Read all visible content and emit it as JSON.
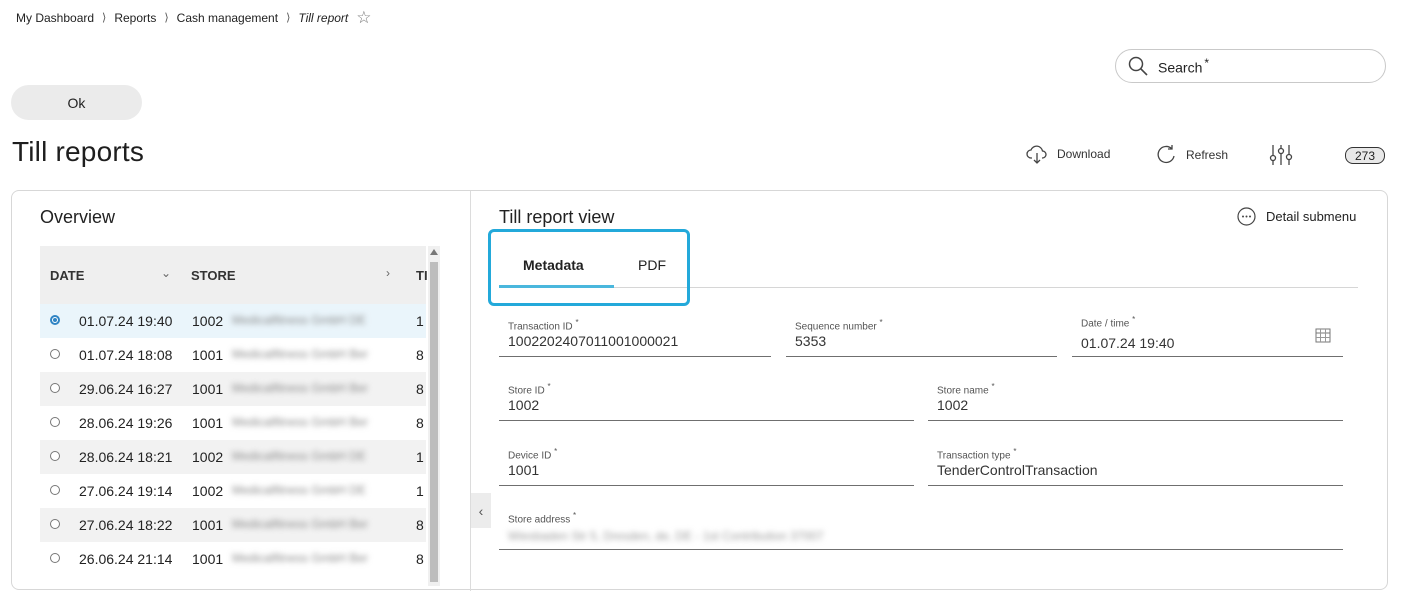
{
  "breadcrumb": {
    "items": [
      "My Dashboard",
      "Reports",
      "Cash management"
    ],
    "current": "Till report"
  },
  "search": {
    "placeholder": "Search",
    "required_mark": "*"
  },
  "ok_button": "Ok",
  "page_title": "Till reports",
  "toolbar": {
    "download_label": "Download",
    "refresh_label": "Refresh",
    "count": "273"
  },
  "overview": {
    "title": "Overview",
    "columns": {
      "date": "DATE",
      "store": "STORE",
      "extra": "TI"
    },
    "rows": [
      {
        "date": "01.07.24 19:40",
        "store": "1002",
        "name": "Medicalfitness GmbH DE",
        "extra": "1",
        "selected": true
      },
      {
        "date": "01.07.24 18:08",
        "store": "1001",
        "name": "Medicalfitness GmbH Ber",
        "extra": "8"
      },
      {
        "date": "29.06.24 16:27",
        "store": "1001",
        "name": "Medicalfitness GmbH Ber",
        "extra": "8"
      },
      {
        "date": "28.06.24 19:26",
        "store": "1001",
        "name": "Medicalfitness GmbH Ber",
        "extra": "8"
      },
      {
        "date": "28.06.24 18:21",
        "store": "1002",
        "name": "Medicalfitness GmbH DE",
        "extra": "1"
      },
      {
        "date": "27.06.24 19:14",
        "store": "1002",
        "name": "Medicalfitness GmbH DE",
        "extra": "1"
      },
      {
        "date": "27.06.24 18:22",
        "store": "1001",
        "name": "Medicalfitness GmbH Ber",
        "extra": "8"
      },
      {
        "date": "26.06.24 21:14",
        "store": "1001",
        "name": "Medicalfitness GmbH Ber",
        "extra": "8"
      }
    ]
  },
  "view": {
    "title": "Till report view",
    "detail_submenu": "Detail submenu",
    "tabs": [
      "Metadata",
      "PDF"
    ],
    "fields": {
      "transaction_id": {
        "label": "Transaction ID",
        "value": "1002202407011001000021"
      },
      "sequence_number": {
        "label": "Sequence number",
        "value": "5353"
      },
      "date_time": {
        "label": "Date / time",
        "value": "01.07.24 19:40"
      },
      "store_id": {
        "label": "Store ID",
        "value": "1002"
      },
      "store_name": {
        "label": "Store name",
        "value": "1002"
      },
      "device_id": {
        "label": "Device ID",
        "value": "1001"
      },
      "transaction_type": {
        "label": "Transaction type",
        "value": "TenderControlTransaction"
      },
      "store_address": {
        "label": "Store address",
        "value": "Wiesbaden Str 5, Dresden, de, DE - 1st Contribution 37007"
      }
    },
    "required_mark": "*"
  }
}
